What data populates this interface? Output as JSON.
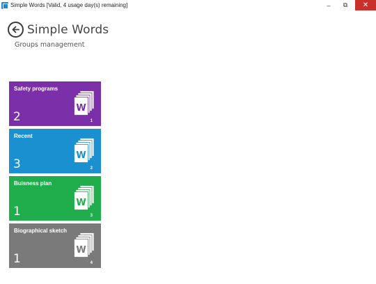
{
  "window": {
    "title": "Simple Words [Valid, 4 usage day(s) remaining]",
    "controls": {
      "minimize": "–",
      "restore": "⧉",
      "close": "✕"
    }
  },
  "header": {
    "title": "Simple Words",
    "subtitle": "Groups management"
  },
  "groups": [
    {
      "name": "Safety programs",
      "count": "2",
      "index": "1",
      "color": "#7b2fa8"
    },
    {
      "name": "Recent",
      "count": "3",
      "index": "2",
      "color": "#1a90d0"
    },
    {
      "name": "Buisness plan",
      "count": "1",
      "index": "3",
      "color": "#1fae4b"
    },
    {
      "name": "Biographical sketch",
      "count": "1",
      "index": "4",
      "color": "#7a7a7a"
    }
  ],
  "icons": {
    "back": "back-arrow-icon",
    "document": "word-document-stack-icon",
    "app": "app-icon"
  }
}
